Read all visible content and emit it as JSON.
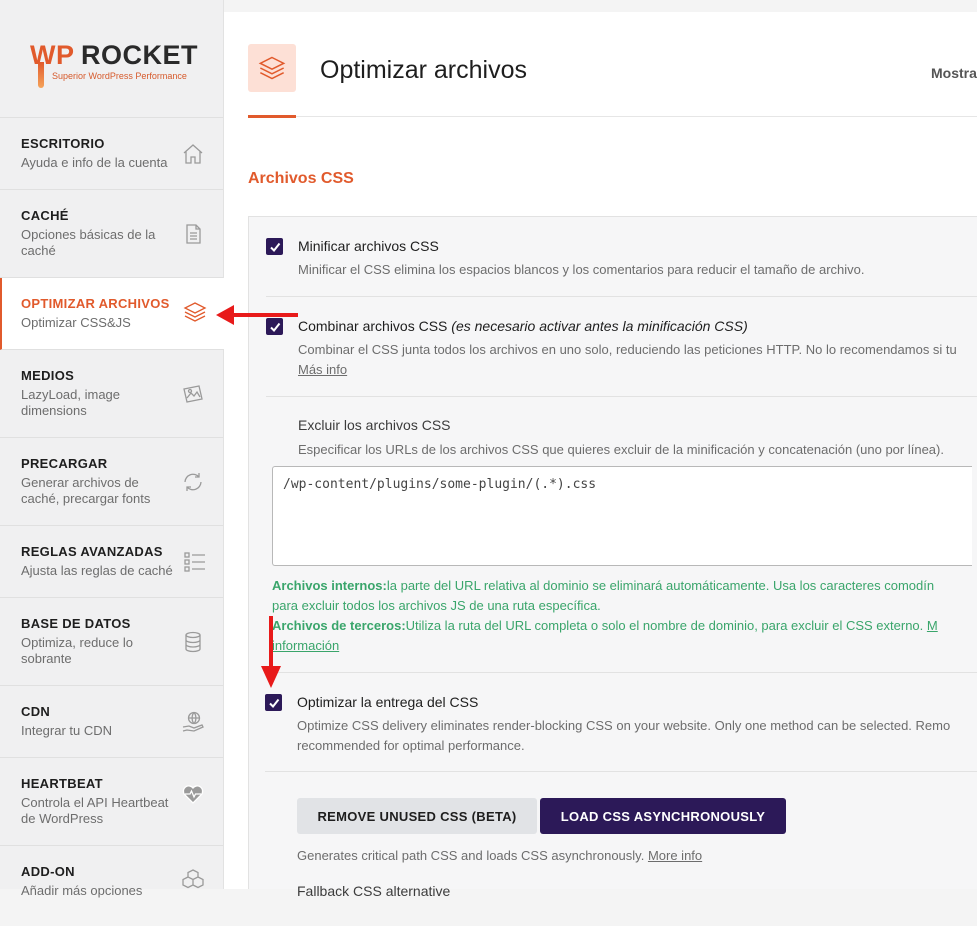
{
  "logo": {
    "wp": "WP",
    "rocket": "ROCKET",
    "tagline": "Superior WordPress Performance"
  },
  "sidebar": {
    "items": [
      {
        "title": "ESCRITORIO",
        "sub": "Ayuda e info de la cuenta",
        "icon": "home-icon"
      },
      {
        "title": "CACHÉ",
        "sub": "Opciones básicas de la caché",
        "icon": "file-icon"
      },
      {
        "title": "OPTIMIZAR ARCHIVOS",
        "sub": "Optimizar CSS&JS",
        "icon": "layers-icon"
      },
      {
        "title": "MEDIOS",
        "sub": "LazyLoad, image dimensions",
        "icon": "images-icon"
      },
      {
        "title": "PRECARGAR",
        "sub": "Generar archivos de caché, precargar fonts",
        "icon": "refresh-icon"
      },
      {
        "title": "REGLAS AVANZADAS",
        "sub": "Ajusta las reglas de caché",
        "icon": "checklist-icon"
      },
      {
        "title": "BASE DE DATOS",
        "sub": "Optimiza, reduce lo sobrante",
        "icon": "database-icon"
      },
      {
        "title": "CDN",
        "sub": "Integrar tu CDN",
        "icon": "globe-hand-icon"
      },
      {
        "title": "HEARTBEAT",
        "sub": "Controla el API Heartbeat de WordPress",
        "icon": "heartbeat-icon"
      },
      {
        "title": "ADD-ON",
        "sub": "Añadir más opciones",
        "icon": "cubes-icon"
      }
    ]
  },
  "header": {
    "title": "Optimizar archivos",
    "right": "Mostra"
  },
  "section": {
    "title": "Archivos CSS"
  },
  "options": {
    "minify": {
      "label": "Minificar archivos CSS",
      "desc": "Minificar el CSS elimina los espacios blancos y los comentarios para reducir el tamaño de archivo."
    },
    "combine": {
      "label": "Combinar archivos CSS",
      "label_note": "(es necesario activar antes la minificación CSS)",
      "desc": "Combinar el CSS junta todos los archivos en uno solo, reduciendo las peticiones HTTP. No lo recomendamos si tu",
      "link": "Más info"
    },
    "exclude": {
      "label": "Excluir los archivos CSS",
      "desc": "Especificar los URLs de los archivos CSS que quieres excluir de la minificación y concatenación (uno por línea).",
      "value": "/wp-content/plugins/some-plugin/(.*).css",
      "help1_bold": "Archivos internos:",
      "help1": "la parte del URL relativa al dominio se eliminará automáticamente. Usa los caracteres comodín",
      "help1_line2": "para excluir todos los archivos JS de una ruta específica.",
      "help2_bold": "Archivos de terceros:",
      "help2": "Utiliza la ruta del URL completa o solo el nombre de dominio, para excluir el CSS externo.",
      "help2_link_a": "M",
      "help2_link_b": "información"
    },
    "delivery": {
      "label": "Optimizar la entrega del CSS",
      "desc1": "Optimize CSS delivery eliminates render-blocking CSS on your website. Only one method can be selected. Remo",
      "desc2": "recommended for optimal performance."
    }
  },
  "buttons": {
    "remove_unused": "REMOVE UNUSED CSS (BETA)",
    "load_async": "LOAD CSS ASYNCHRONOUSLY"
  },
  "async_note": {
    "text": "Generates critical path CSS and loads CSS asynchronously.",
    "link": "More info"
  },
  "cut_off_text": "Fallback CSS alternative",
  "colors": {
    "accent": "#e15a2c",
    "purple": "#2c1958",
    "green": "#3aa56b",
    "arrow": "#e81a1a"
  }
}
